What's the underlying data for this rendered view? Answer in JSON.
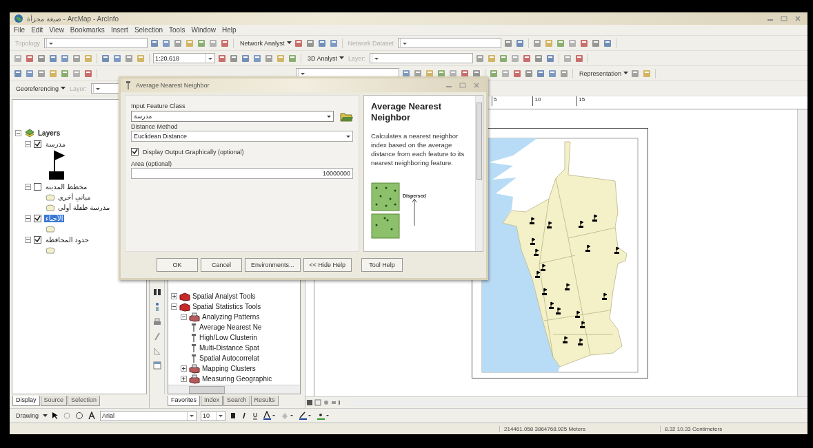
{
  "window": {
    "title": "صيغة مجزأة - ArcMap - ArcInfo"
  },
  "menu": [
    "File",
    "Edit",
    "View",
    "Bookmarks",
    "Insert",
    "Selection",
    "Tools",
    "Window",
    "Help"
  ],
  "toolbars": [
    {
      "items": [
        {
          "kind": "label",
          "text": "Topology",
          "disabled": true
        },
        {
          "kind": "combo"
        },
        {
          "kind": "tools-long"
        },
        {
          "kind": "menu",
          "text": "Network Analyst"
        },
        {
          "kind": "tools"
        },
        {
          "kind": "label",
          "text": "Network Dataset",
          "disabled": true
        },
        {
          "kind": "combo"
        },
        {
          "kind": "tools-short"
        },
        {
          "kind": "tools-long"
        }
      ]
    },
    {
      "items": [
        {
          "kind": "tools-long"
        },
        {
          "kind": "tools"
        },
        {
          "kind": "combo",
          "value": "1:20,618"
        },
        {
          "kind": "tools-long"
        },
        {
          "kind": "menu",
          "text": "3D Analyst"
        },
        {
          "kind": "label",
          "text": "Layer:",
          "disabled": true
        },
        {
          "kind": "combo"
        },
        {
          "kind": "tools-long"
        },
        {
          "kind": "tools-short"
        }
      ]
    },
    {
      "items": [
        {
          "kind": "tools-long"
        },
        {
          "kind": "spacer"
        },
        {
          "kind": "combo"
        },
        {
          "kind": "tools-long"
        },
        {
          "kind": "tools-long"
        },
        {
          "kind": "menu",
          "text": "Representation"
        },
        {
          "kind": "tools-short"
        }
      ]
    },
    {
      "items": [
        {
          "kind": "menu",
          "text": "Georeferencing"
        },
        {
          "kind": "label",
          "text": "Layer:",
          "disabled": true
        },
        {
          "kind": "combo"
        }
      ]
    }
  ],
  "toc": {
    "root": "Layers",
    "layers": [
      {
        "name": "مدرسة",
        "checked": true,
        "selected": false,
        "legend": [
          {
            "kind": "flag"
          }
        ]
      },
      {
        "name": "مخطط المدينة",
        "checked": false,
        "selected": false,
        "legend": [
          {
            "kind": "swatch",
            "label": "مباني أخرى"
          },
          {
            "kind": "swatch",
            "label": "مدرسة طفلة أولى"
          }
        ]
      },
      {
        "name": "الأحياء",
        "checked": true,
        "selected": true,
        "legend": [
          {
            "kind": "swatch"
          }
        ]
      },
      {
        "name": "حدود المحافظة",
        "checked": true,
        "selected": false,
        "legend": [
          {
            "kind": "swatch"
          }
        ]
      }
    ],
    "tabs": [
      {
        "label": "Display",
        "selected": true
      },
      {
        "label": "Source",
        "selected": false
      },
      {
        "label": "Selection",
        "selected": false
      }
    ]
  },
  "toolbox": {
    "tree": [
      {
        "label": "Spatial Analyst Tools",
        "kind": "toolbox",
        "expanded": false
      },
      {
        "label": "Spatial Statistics Tools",
        "kind": "toolbox",
        "expanded": true,
        "children": [
          {
            "label": "Analyzing Patterns",
            "kind": "toolset",
            "expanded": true,
            "children": [
              {
                "label": "Average Nearest Ne",
                "kind": "tool"
              },
              {
                "label": "High/Low Clusterin",
                "kind": "tool"
              },
              {
                "label": "Multi-Distance Spat",
                "kind": "tool"
              },
              {
                "label": "Spatial Autocorrelat",
                "kind": "tool"
              }
            ]
          },
          {
            "label": "Mapping Clusters",
            "kind": "toolset",
            "expanded": false
          },
          {
            "label": "Measuring Geographic",
            "kind": "toolset",
            "expanded": false
          }
        ]
      }
    ],
    "tabs": [
      {
        "label": "Favorites",
        "selected": true
      },
      {
        "label": "Index",
        "selected": false
      },
      {
        "label": "Search",
        "selected": false
      },
      {
        "label": "Results",
        "selected": false
      }
    ]
  },
  "map": {
    "ruler": [
      "5",
      "10",
      "15"
    ]
  },
  "dialog": {
    "title": "Average Nearest Neighbor",
    "fields": [
      {
        "kind": "dropdown",
        "label": "Input Feature Class",
        "value": "مدرسة",
        "browse": true
      },
      {
        "kind": "dropdown",
        "label": "Distance Method",
        "value": "Euclidean Distance",
        "browse": false
      },
      {
        "kind": "checkbox",
        "label": "Display Output Graphically (optional)",
        "checked": true
      },
      {
        "kind": "text",
        "label": "Area (optional)",
        "value": "10000000"
      }
    ],
    "help": {
      "title": "Average Nearest Neighbor",
      "text": "Calculates a nearest neighbor index based on the average distance from each feature to its nearest neighboring feature.",
      "figure_label": "Dispersed"
    },
    "buttons": [
      "OK",
      "Cancel",
      "Environments...",
      "<< Hide Help",
      "Tool Help"
    ]
  },
  "drawing": {
    "menu": "Drawing",
    "font": "Arial",
    "size": "10"
  },
  "status": [
    "214461.058  3864768.925 Meters",
    "8.32  10.33 Centimeters"
  ]
}
